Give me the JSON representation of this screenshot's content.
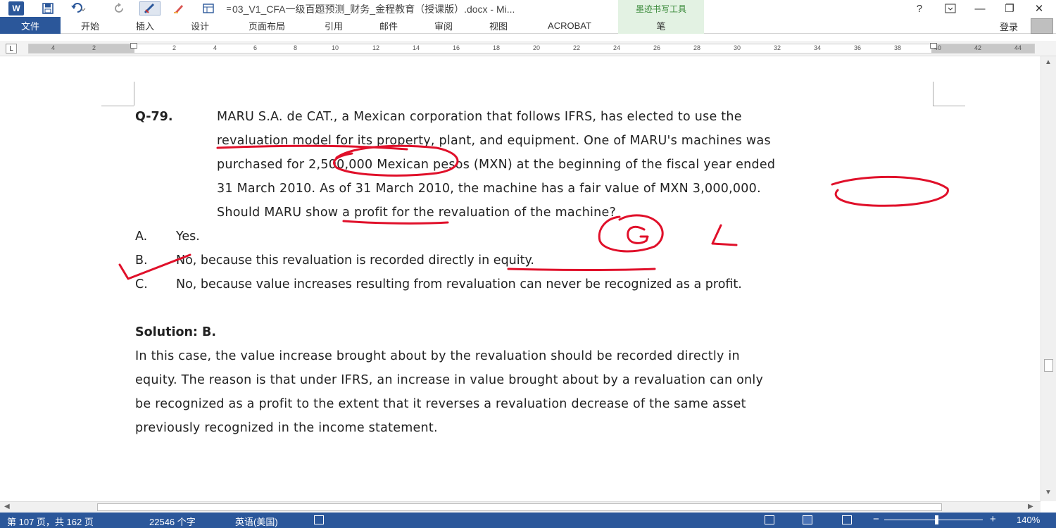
{
  "titlebar": {
    "word_icon": "W",
    "document_title": "03_V1_CFA一级百题预测_财务_金程教育（授课版）.docx - Mi...",
    "tool_group_label": "墨迹书写工具",
    "help": "?",
    "minimize": "—",
    "restore": "❐",
    "close": "✕"
  },
  "ribbon": {
    "tabs": [
      "文件",
      "开始",
      "插入",
      "设计",
      "页面布局",
      "引用",
      "邮件",
      "审阅",
      "视图",
      "ACROBAT",
      "笔"
    ],
    "login": "登录"
  },
  "ruler": {
    "corner_symbol": "L",
    "numbers": [
      "4",
      "2",
      "2",
      "4",
      "6",
      "8",
      "10",
      "12",
      "14",
      "16",
      "18",
      "20",
      "22",
      "24",
      "26",
      "28",
      "30",
      "32",
      "34",
      "36",
      "38",
      "40",
      "42",
      "44"
    ]
  },
  "document": {
    "question_number": "Q-79.",
    "question_lines": [
      "MARU S.A. de CAT., a Mexican corporation that follows IFRS, has elected to use the",
      "revaluation model for its property, plant, and equipment. One of MARU's machines was",
      "purchased for 2,500,000 Mexican pesos (MXN) at the beginning of the fiscal year ended",
      "31 March 2010. As of 31 March 2010, the machine has a fair value of MXN 3,000,000.",
      "Should MARU show a profit for the revaluation of the machine?"
    ],
    "options": [
      {
        "letter": "A.",
        "text": "Yes."
      },
      {
        "letter": "B.",
        "text": "No, because this revaluation is recorded directly in equity."
      },
      {
        "letter": "C.",
        "text": "No, because value increases resulting from revaluation can never be recognized as a profit."
      }
    ],
    "solution_heading": "Solution: B.",
    "solution_lines": [
      "In this case, the value increase brought about by the revaluation should be recorded directly in",
      "equity. The reason is that under IFRS, an increase in value brought about by a revaluation can only",
      "be recognized as a profit to the extent that it reverses a revaluation decrease of the same asset",
      "previously recognized in the income statement."
    ],
    "ink_color": "#e0102a"
  },
  "statusbar": {
    "page": "第 107 页，共 162 页",
    "words": "22546 个字",
    "language": "英语(美国)",
    "zoom": "140%",
    "zoom_minus": "−",
    "zoom_plus": "+",
    "color": "#2b579a"
  }
}
